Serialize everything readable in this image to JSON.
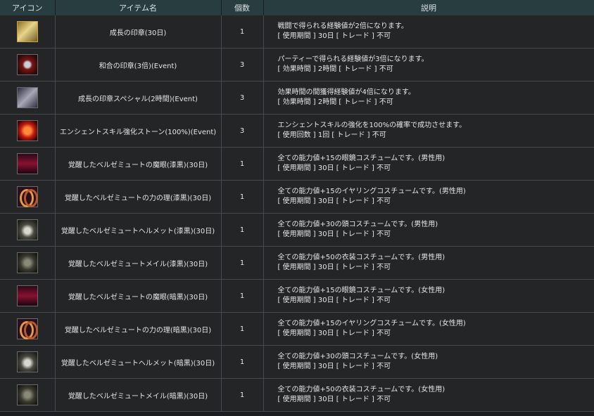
{
  "headers": {
    "icon": "アイコン",
    "name": "アイテム名",
    "qty": "個数",
    "desc": "説明"
  },
  "rows": [
    {
      "icon": "book-icon",
      "name": "成長の印章(30日)",
      "qty": "1",
      "desc1": "戦闘で得られる経験値が2倍になります。",
      "desc2": "[ 使用期間 ] 30日 [ トレード ] 不可"
    },
    {
      "icon": "dynamite-icon",
      "name": "和合の印章(3倍)(Event)",
      "qty": "3",
      "desc1": "パーティーで得られる経験値が3倍になります。",
      "desc2": "[ 効果時間 ] 2時間 [ トレード ] 不可"
    },
    {
      "icon": "scroll-icon",
      "name": "成長の印章スペシャル(2時間)(Event)",
      "qty": "3",
      "desc1": "効果時間の間獲得経験値が4倍になります。",
      "desc2": "[ 効果時間 ] 2時間 [ トレード ] 不可"
    },
    {
      "icon": "orb-icon",
      "name": "エンシェントスキル強化ストーン(100%)(Event)",
      "qty": "3",
      "desc1": "エンシェントスキルの強化を100%の確率で成功させます。",
      "desc2": "[ 使用回数 ] 1回 [ トレード ] 不可"
    },
    {
      "icon": "eyepatch-icon",
      "name": "覚醒したベルゼミュートの魔眼(漆黒)(30日)",
      "qty": "1",
      "desc1": "全ての能力値+15の眼鏡コスチュームです。(男性用)",
      "desc2": "[ 使用期間 ] 30日 [ トレード ] 不可"
    },
    {
      "icon": "ring-icon",
      "name": "覚醒したベルゼミュートの力の理(漆黒)(30日)",
      "qty": "1",
      "desc1": "全ての能力値+15のイヤリングコスチュームです。(男性用)",
      "desc2": "[ 使用期間 ] 30日 [ トレード ] 不可"
    },
    {
      "icon": "helmet-icon",
      "name": "覚醒したベルゼミュートヘルメット(漆黒)(30日)",
      "qty": "1",
      "desc1": "全ての能力値+30の頭コスチュームです。(男性用)",
      "desc2": "[ 使用期間 ] 30日 [ トレード ] 不可"
    },
    {
      "icon": "armor-icon",
      "name": "覚醒したベルゼミュートメイル(漆黒)(30日)",
      "qty": "1",
      "desc1": "全ての能力値+50の衣装コスチュームです。(男性用)",
      "desc2": "[ 使用期間 ] 30日 [ トレード ] 不可"
    },
    {
      "icon": "eyepatch-icon",
      "name": "覚醒したベルゼミュートの魔眼(暗黒)(30日)",
      "qty": "1",
      "desc1": "全ての能力値+15の眼鏡コスチュームです。(女性用)",
      "desc2": "[ 使用期間 ] 30日 [ トレード ] 不可"
    },
    {
      "icon": "ring-icon",
      "name": "覚醒したベルゼミュートの力の理(暗黒)(30日)",
      "qty": "1",
      "desc1": "全ての能力値+15のイヤリングコスチュームです。(女性用)",
      "desc2": "[ 使用期間 ] 30日 [ トレード ] 不可"
    },
    {
      "icon": "helmet-icon",
      "name": "覚醒したベルゼミュートヘルメット(暗黒)(30日)",
      "qty": "1",
      "desc1": "全ての能力値+30の頭コスチュームです。(女性用)",
      "desc2": "[ 使用期間 ] 30日 [ トレード ] 不可"
    },
    {
      "icon": "armor-icon",
      "name": "覚醒したベルゼミュートメイル(暗黒)(30日)",
      "qty": "1",
      "desc1": "全ての能力値+50の衣装コスチュームです。(女性用)",
      "desc2": "[ 使用期間 ] 30日 [ トレード ] 不可"
    }
  ]
}
